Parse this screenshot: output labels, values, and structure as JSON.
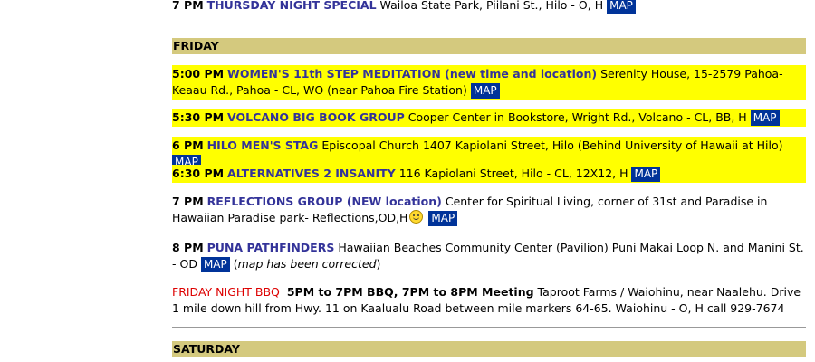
{
  "map_label": "MAP",
  "prev": {
    "time": "7 PM",
    "group": "THURSDAY NIGHT SPECIAL",
    "desc": "Wailoa State Park, Piilani St., Hilo - O, H"
  },
  "friday": {
    "header": "FRIDAY",
    "entries": [
      {
        "time": "5:00 PM",
        "group": "WOMEN'S 11th STEP MEDITATION (new time and location)",
        "desc": "Serenity House, 15-2579 Pahoa-Keaau Rd., Pahoa - CL, WO (near Pahoa Fire Station)"
      },
      {
        "time": "5:30 PM",
        "group": "VOLCANO BIG BOOK GROUP",
        "desc": "Cooper Center in Bookstore, Wright Rd., Volcano - CL, BB, H"
      },
      {
        "time": "6 PM",
        "group": "HILO MEN'S STAG",
        "desc": "Episcopal Church 1407 Kapiolani Street, Hilo (Behind University of Hawaii at Hilo)"
      },
      {
        "time": "6:30 PM",
        "group": "ALTERNATIVES 2 INSANITY",
        "desc": "116 Kapiolani Street, Hilo - CL, 12X12, H"
      },
      {
        "time": "7 PM",
        "group": "REFLECTIONS GROUP (NEW location)",
        "desc": "Center for Spiritual Living, corner of 31st and Paradise in Hawaiian Paradise park- Reflections,OD,H"
      },
      {
        "time": "8 PM",
        "group": "PUNA PATHFINDERS",
        "desc": "Hawaiian Beaches Community Center (Pavilion) Puni Makai Loop N. and Manini St. - OD",
        "note": "map has been corrected"
      }
    ],
    "bbq": {
      "label": "FRIDAY NIGHT BBQ",
      "bold": "5PM to 7PM BBQ, 7PM to 8PM Meeting",
      "desc": "Taproot Farms / Waiohinu, near Naalehu. Drive 1 mile down hill from Hwy. 11 on Kaalualu Road between mile markers 64-65. Waiohinu - O, H call 929-7674"
    }
  },
  "saturday": {
    "header": "SATURDAY"
  },
  "colors": {
    "highlight": "#ffff00",
    "group_name": "#333399",
    "map_button": "#003399",
    "day_header": "#d4c97e",
    "bbq_label": "#dd0000"
  }
}
